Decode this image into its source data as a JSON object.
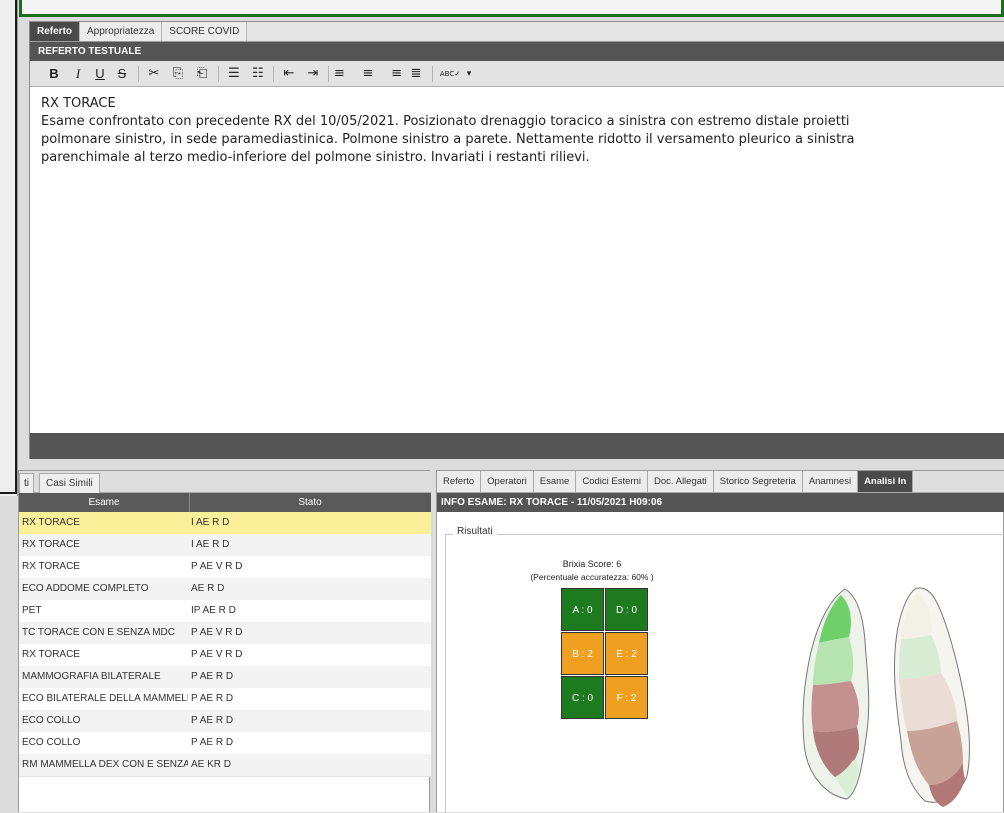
{
  "colors": {
    "green_frame": "#1f6b1f",
    "selected_row": "#fbf09a",
    "score_green": "#1e7a1e",
    "score_orange": "#f0a020",
    "header_dark": "#555555"
  },
  "editor": {
    "tabs": [
      "Referto",
      "Appropriatezza",
      "SCORE COVID"
    ],
    "active_tab": 0,
    "panel_title": "REFERTO TESTUALE",
    "toolbar": {
      "bold": "B",
      "italic": "I",
      "underline": "U",
      "strike": "S",
      "cut": "✂",
      "copy": "⎘",
      "paste": "⎗",
      "ul": "☰",
      "ol": "☷",
      "outdent": "⇤",
      "indent": "⇥",
      "align_left": "≡",
      "align_center": "≡",
      "align_right": "≡",
      "justify": "≣",
      "spellcheck": "ABC✓",
      "spellcheck_caret": "▾"
    },
    "body_title": "RX TORACE",
    "body_lines": [
      "Esame confrontato con precedente RX del 10/05/2021. Posizionato drenaggio toracico a sinistra con estremo distale proietti",
      "polmonare sinistro, in sede paramediastinica. Polmone sinistro a parete. Nettamente ridotto il versamento pleurico a sinistra",
      "parenchimale al terzo medio-inferiore del polmone sinistro. Invariati i restanti rilievi."
    ]
  },
  "grid": {
    "tabs": [
      "ti",
      "Casi Simili"
    ],
    "columns": [
      "Esame",
      "Stato"
    ],
    "rows": [
      {
        "esame": "RX TORACE",
        "stato": "I AE R D",
        "selected": true
      },
      {
        "esame": "RX TORACE",
        "stato": "I AE R D",
        "selected": false
      },
      {
        "esame": "RX TORACE",
        "stato": "P AE V R D",
        "selected": false
      },
      {
        "esame": "ECO ADDOME COMPLETO",
        "stato": "AE R D",
        "selected": false
      },
      {
        "esame": "PET",
        "stato": "IP AE R D",
        "selected": false
      },
      {
        "esame": "TC TORACE CON E SENZA MDC",
        "stato": "P AE V R D",
        "selected": false
      },
      {
        "esame": "RX TORACE",
        "stato": "P AE V R D",
        "selected": false
      },
      {
        "esame": "MAMMOGRAFIA BILATERALE",
        "stato": "P AE R D",
        "selected": false
      },
      {
        "esame": "ECO BILATERALE DELLA MAMMELLA",
        "stato": "P AE R D",
        "selected": false
      },
      {
        "esame": "ECO COLLO",
        "stato": "P AE R D",
        "selected": false
      },
      {
        "esame": "ECO COLLO",
        "stato": "P AE R D",
        "selected": false
      },
      {
        "esame": "RM MAMMELLA DEX CON E SENZA",
        "stato": "AE KR D",
        "selected": false
      }
    ]
  },
  "info": {
    "tabs": [
      "Referto",
      "Operatori",
      "Esame",
      "Codici Esterni",
      "Doc. Allegati",
      "Storico Segreteria",
      "Anamnesi",
      "Analisi In"
    ],
    "active_tab": 7,
    "title": "INFO ESAME: RX TORACE - 11/05/2021 H09:06",
    "results_label": "Risultati",
    "brixia_title": "Brixia Score: 6",
    "brixia_subtitle": "(Percentuale accuratezza: 60% )",
    "cells": [
      {
        "label": "A : 0",
        "level": "green"
      },
      {
        "label": "D : 0",
        "level": "green"
      },
      {
        "label": "B : 2",
        "level": "orange"
      },
      {
        "label": "E : 2",
        "level": "orange"
      },
      {
        "label": "C : 0",
        "level": "green"
      },
      {
        "label": "F : 2",
        "level": "orange"
      }
    ]
  }
}
